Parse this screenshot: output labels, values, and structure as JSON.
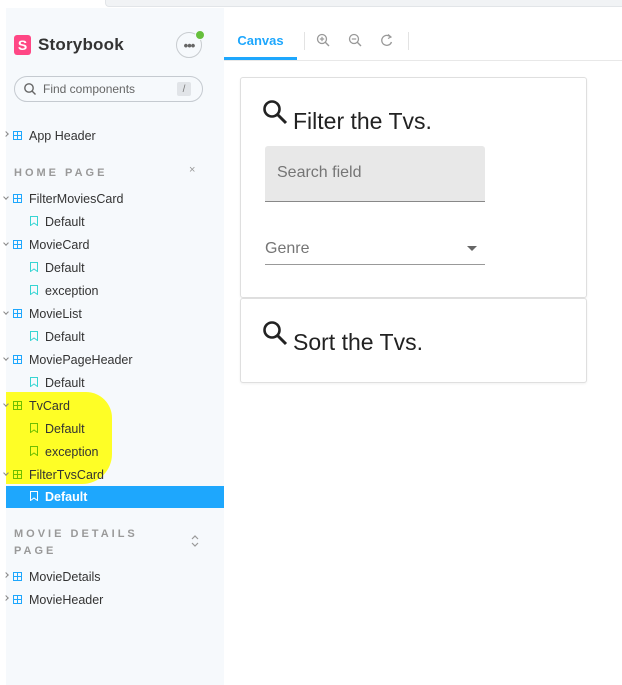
{
  "brand": {
    "logo_letter": "S",
    "name": "Storybook"
  },
  "menu": {
    "label": "•••"
  },
  "search": {
    "placeholder": "Find components",
    "shortcut": "/"
  },
  "sidebar": {
    "top_item": "App Header",
    "sections": [
      {
        "title": "HOME PAGE",
        "toggle": "×",
        "components": [
          {
            "name": "FilterMoviesCard",
            "stories": [
              "Default"
            ]
          },
          {
            "name": "MovieCard",
            "stories": [
              "Default",
              "exception"
            ]
          },
          {
            "name": "MovieList",
            "stories": [
              "Default"
            ]
          },
          {
            "name": "MoviePageHeader",
            "stories": [
              "Default"
            ]
          },
          {
            "name": "TvCard",
            "stories": [
              "Default",
              "exception"
            ]
          },
          {
            "name": "FilterTvsCard",
            "stories": [
              "Default"
            ]
          }
        ]
      },
      {
        "title_line1": "MOVIE DETAILS",
        "title_line2": "PAGE",
        "toggle": "⌃⌄",
        "components": [
          {
            "name": "MovieDetails"
          },
          {
            "name": "MovieHeader"
          }
        ]
      }
    ],
    "selected_story": "FilterTvsCard / Default",
    "highlight_color": "#ffff00",
    "accent": "#1ea7fd"
  },
  "toolbar": {
    "tab": "Canvas",
    "tools": [
      "zoom-in-icon",
      "zoom-out-icon",
      "reset-zoom-icon"
    ]
  },
  "preview": {
    "filter_card": {
      "title": "Filter the Tvs.",
      "search_placeholder": "Search field",
      "genre_label": "Genre"
    },
    "sort_card": {
      "title": "Sort the Tvs."
    }
  }
}
